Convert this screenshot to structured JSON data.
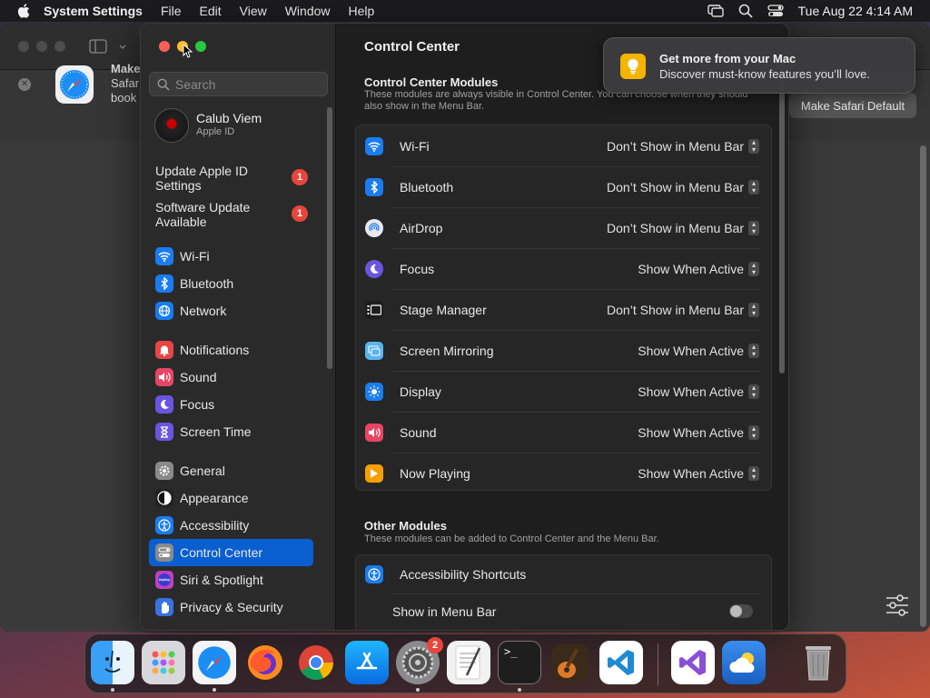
{
  "menubar": {
    "app_name": "System Settings",
    "menus": [
      "File",
      "Edit",
      "View",
      "Window",
      "Help"
    ],
    "clock": "Tue Aug 22  4:14 AM"
  },
  "safari": {
    "banner_title": "Make",
    "banner_line2": "Safar",
    "banner_line3": "book",
    "make_default_label": "Make Safari Default"
  },
  "notification": {
    "title": "Get more from your Mac",
    "body": "Discover must-know features you’ll love."
  },
  "sidebar": {
    "search_placeholder": "Search",
    "user_name": "Calub Viem",
    "user_sub": "Apple ID",
    "updates": [
      {
        "label": "Update Apple ID Settings",
        "badge": "1"
      },
      {
        "label": "Software Update Available",
        "badge": "1"
      }
    ],
    "items": [
      {
        "label": "Wi-Fi",
        "color": "#1a7cf0"
      },
      {
        "label": "Bluetooth",
        "color": "#1a7cf0"
      },
      {
        "label": "Network",
        "color": "#1a7cf0"
      },
      {
        "label": "Notifications",
        "color": "#e84545"
      },
      {
        "label": "Sound",
        "color": "#e84565"
      },
      {
        "label": "Focus",
        "color": "#6a55e0"
      },
      {
        "label": "Screen Time",
        "color": "#6a55e0"
      },
      {
        "label": "General",
        "color": "#8a8a8a"
      },
      {
        "label": "Appearance",
        "color": "#222222"
      },
      {
        "label": "Accessibility",
        "color": "#1a7cf0"
      },
      {
        "label": "Control Center",
        "color": "#8a8a8a"
      },
      {
        "label": "Siri & Spotlight",
        "color": "#c040c0"
      },
      {
        "label": "Privacy & Security",
        "color": "#3a70e0"
      }
    ],
    "selected": "Control Center"
  },
  "main": {
    "title": "Control Center",
    "modules_header": "Control Center Modules",
    "modules_desc": "These modules are always visible in Control Center. You can choose when they should also show in the Menu Bar.",
    "modules": [
      {
        "label": "Wi-Fi",
        "value": "Don’t Show in Menu Bar",
        "color": "#1a7cf0"
      },
      {
        "label": "Bluetooth",
        "value": "Don’t Show in Menu Bar",
        "color": "#1a7cf0"
      },
      {
        "label": "AirDrop",
        "value": "Don’t Show in Menu Bar",
        "color": "#e8e8f0"
      },
      {
        "label": "Focus",
        "value": "Show When Active",
        "color": "#6a55e0"
      },
      {
        "label": "Stage Manager",
        "value": "Don’t Show in Menu Bar",
        "color": "#1e1e1e"
      },
      {
        "label": "Screen Mirroring",
        "value": "Show When Active",
        "color": "#5ab4f0"
      },
      {
        "label": "Display",
        "value": "Show When Active",
        "color": "#1a7cf0"
      },
      {
        "label": "Sound",
        "value": "Show When Active",
        "color": "#e84565"
      },
      {
        "label": "Now Playing",
        "value": "Show When Active",
        "color": "#f5a000"
      }
    ],
    "other_header": "Other Modules",
    "other_desc": "These modules can be added to Control Center and the Menu Bar.",
    "other": [
      {
        "label": "Accessibility Shortcuts",
        "color": "#1a7cf0"
      },
      {
        "label": "Show in Menu Bar"
      }
    ]
  },
  "dock": {
    "system_settings_badge": "2"
  }
}
